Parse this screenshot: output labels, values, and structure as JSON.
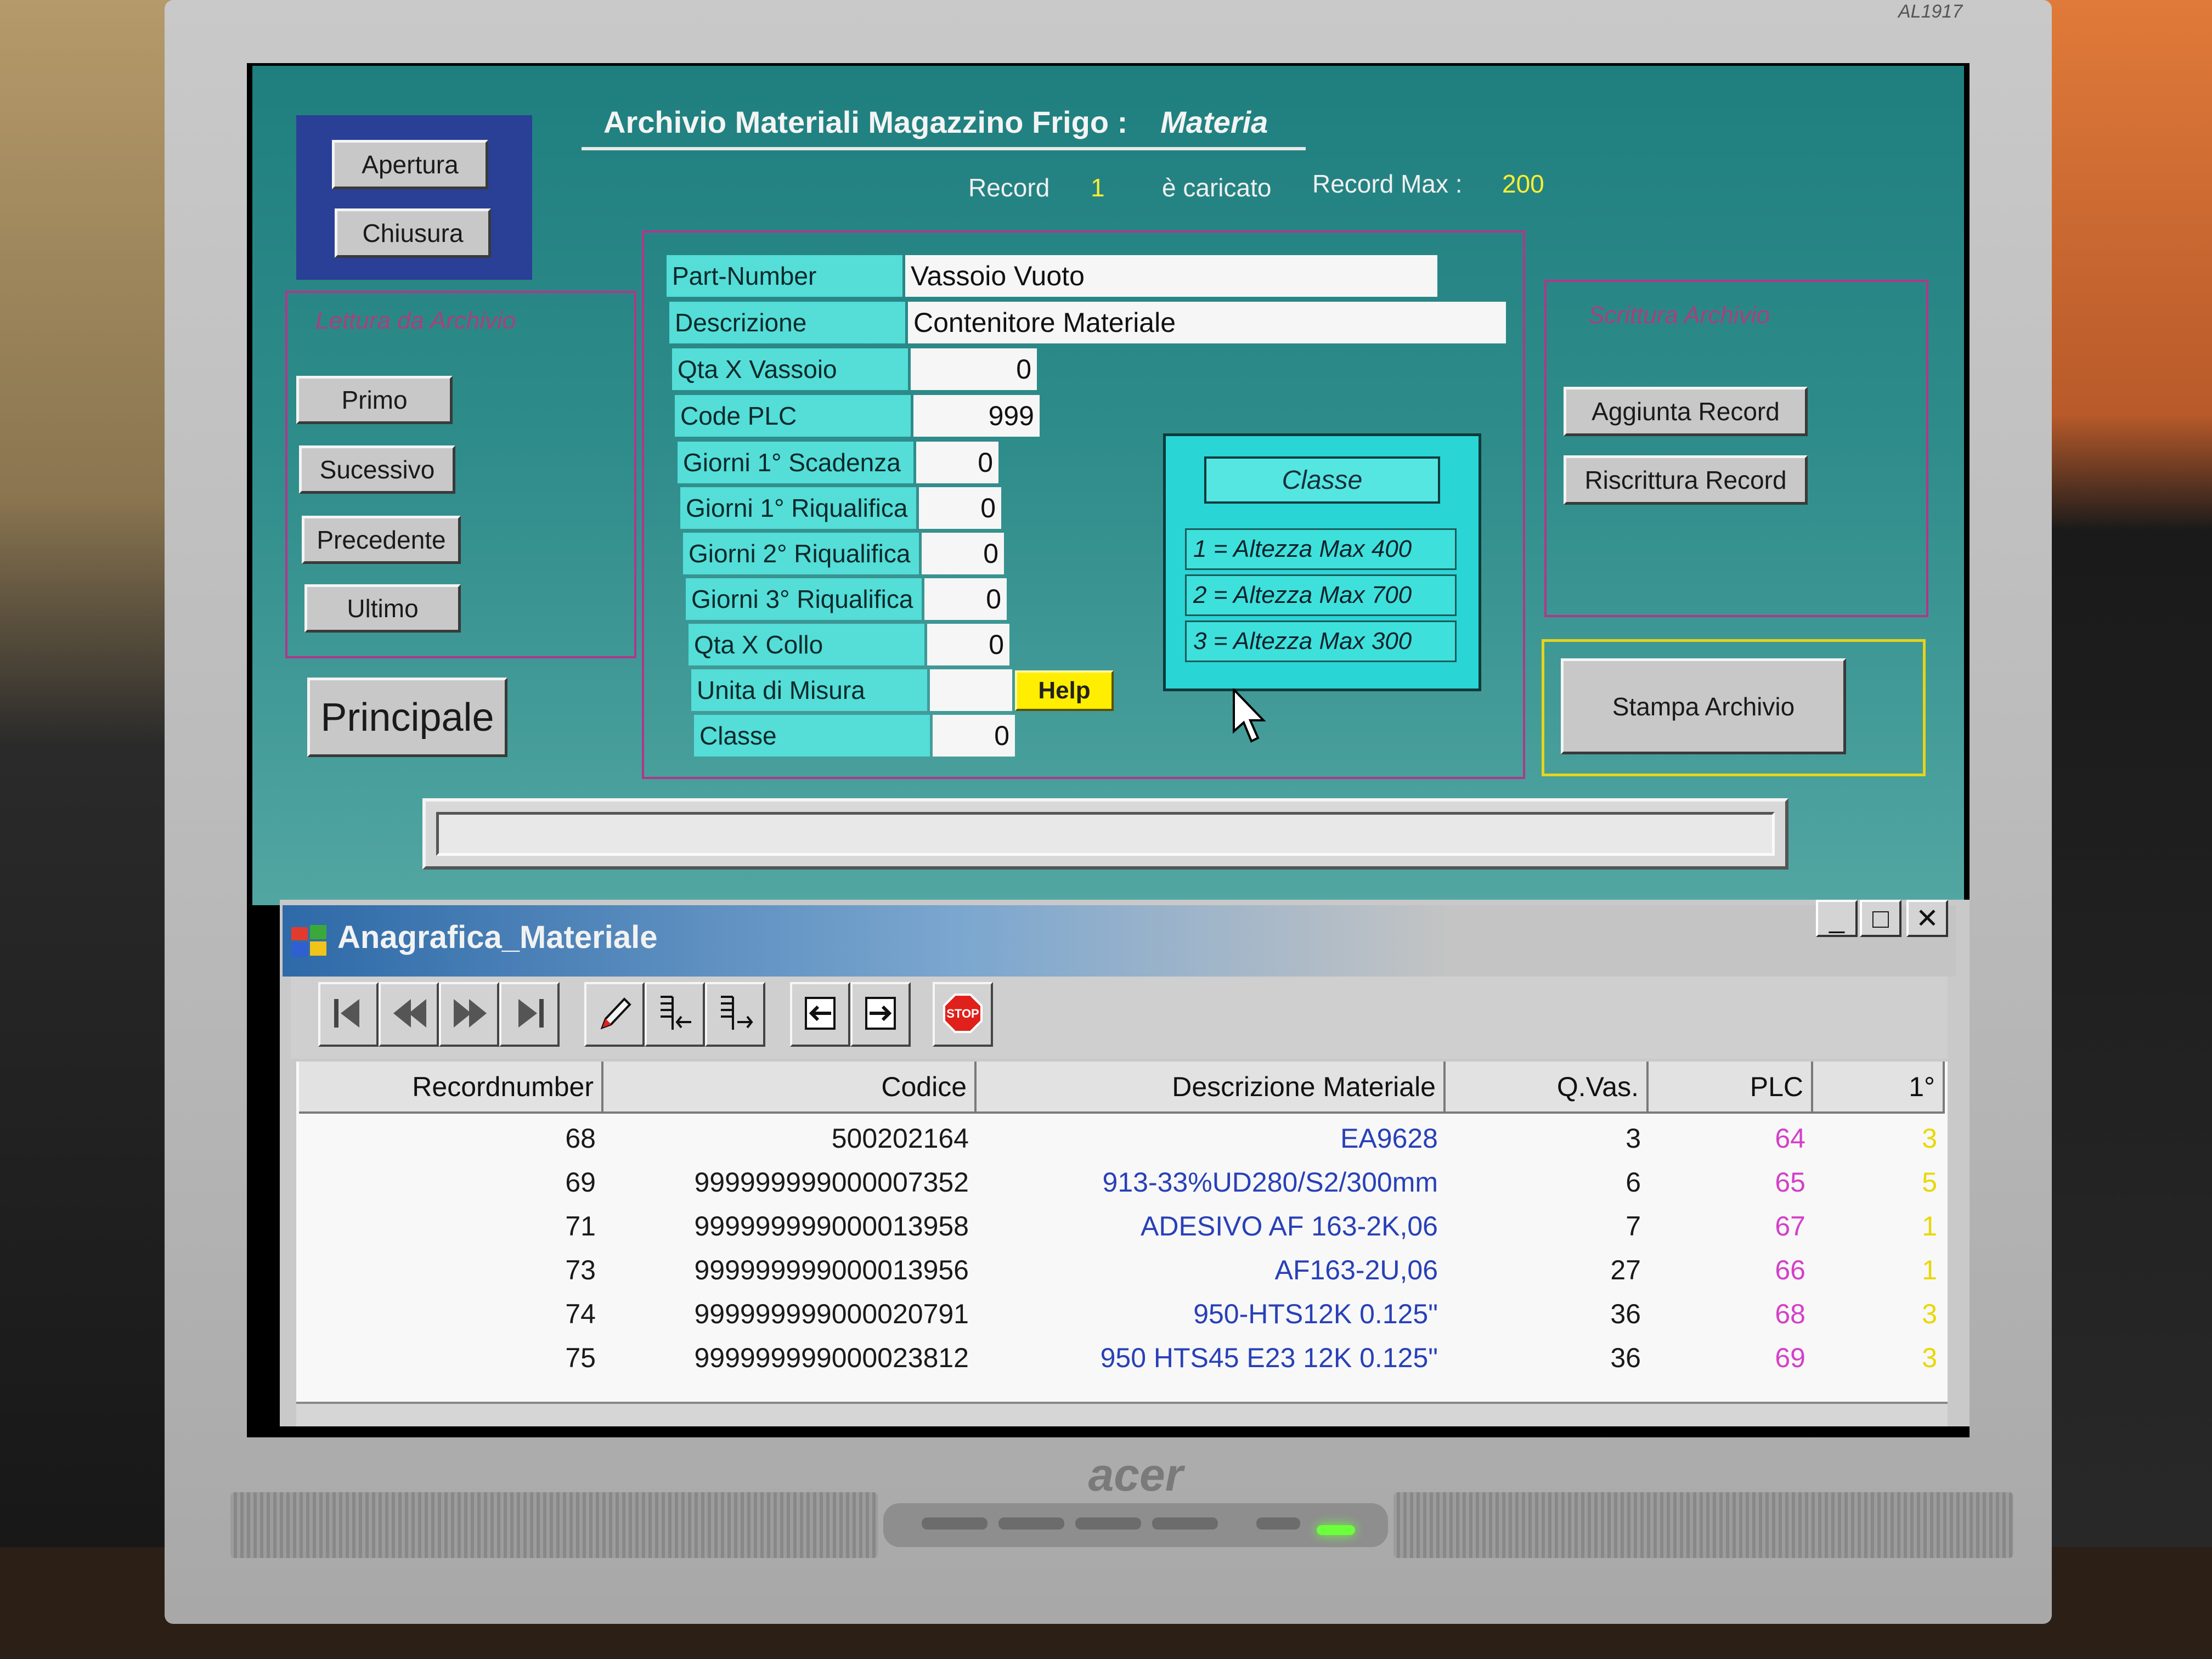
{
  "monitor": {
    "model_label": "AL1917",
    "brand": "acer"
  },
  "app": {
    "title": "Archivio Materiali Magazzino Frigo :",
    "title_italic": "Materia",
    "buttons": {
      "apertura": "Apertura",
      "chiusura": "Chiusura",
      "primo": "Primo",
      "successivo": "Sucessivo",
      "precedente": "Precedente",
      "ultimo": "Ultimo",
      "principale": "Principale",
      "aggiunta_record": "Aggiunta Record",
      "riscrittura_record": "Riscrittura Record",
      "stampa_archivio": "Stampa Archivio",
      "help": "Help"
    },
    "status": {
      "record_label": "Record",
      "record_value": "1",
      "loaded_label": "è caricato",
      "record_max_label": "Record Max :",
      "record_max_value": "200"
    },
    "groups": {
      "lettura": "Lettura da Archivio",
      "scrittura": "Scrittura Archivio"
    },
    "fields": [
      {
        "label": "Part-Number",
        "value": "Vassoio Vuoto"
      },
      {
        "label": "Descrizione",
        "value": "Contenitore Materiale"
      },
      {
        "label": "Qta  X  Vassoio",
        "value": "0"
      },
      {
        "label": "Code PLC",
        "value": "999"
      },
      {
        "label": "Giorni 1° Scadenza",
        "value": "0"
      },
      {
        "label": "Giorni 1° Riqualifica",
        "value": "0"
      },
      {
        "label": "Giorni 2° Riqualifica",
        "value": "0"
      },
      {
        "label": "Giorni 3° Riqualifica",
        "value": "0"
      },
      {
        "label": "Qta X Collo",
        "value": "0"
      },
      {
        "label": "Unita di Misura",
        "value": ""
      },
      {
        "label": "Classe",
        "value": "0"
      }
    ],
    "classe": {
      "header": "Classe",
      "options": [
        "1 = Altezza Max 400",
        "2 = Altezza Max 700",
        "3 = Altezza Max 300"
      ]
    },
    "progress": 0
  },
  "db_window": {
    "title": "Anagrafica_Materiale",
    "controls": {
      "minimize": "_",
      "maximize": "□",
      "close": "✕"
    },
    "toolbar": [
      "first-record-icon",
      "previous-record-icon",
      "next-record-icon",
      "last-record-icon",
      "edit-pencil-icon",
      "insert-before-icon",
      "insert-after-icon",
      "import-icon",
      "export-icon",
      "stop-icon"
    ],
    "stop_label": "STOP",
    "columns": [
      "Recordnumber",
      "Codice",
      "Descrizione Materiale",
      "Q.Vas.",
      "PLC",
      "1°"
    ],
    "rows": [
      {
        "recordnumber": "68",
        "codice": "500202164",
        "descrizione": "EA9628",
        "qvas": "3",
        "plc": "64",
        "first": "3"
      },
      {
        "recordnumber": "69",
        "codice": "999999999000007352",
        "descrizione": "913-33%UD280/S2/300mm",
        "qvas": "6",
        "plc": "65",
        "first": "5"
      },
      {
        "recordnumber": "71",
        "codice": "999999999000013958",
        "descrizione": "ADESIVO AF 163-2K,06",
        "qvas": "7",
        "plc": "67",
        "first": "1"
      },
      {
        "recordnumber": "73",
        "codice": "999999999000013956",
        "descrizione": "AF163-2U,06",
        "qvas": "27",
        "plc": "66",
        "first": "1"
      },
      {
        "recordnumber": "74",
        "codice": "999999999000020791",
        "descrizione": "950-HTS12K 0.125\"",
        "qvas": "36",
        "plc": "68",
        "first": "3"
      },
      {
        "recordnumber": "75",
        "codice": "999999999000023812",
        "descrizione": "950 HTS45 E23 12K 0.125\"",
        "qvas": "36",
        "plc": "69",
        "first": "3"
      }
    ]
  }
}
